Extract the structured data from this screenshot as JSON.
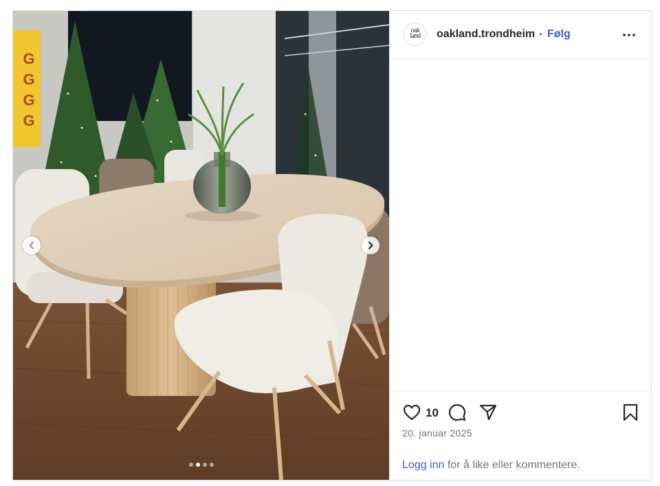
{
  "post": {
    "media": {
      "banner_letters": [
        "G",
        "G",
        "G",
        "G"
      ],
      "slide_index": 2,
      "slide_count": 4
    },
    "header": {
      "avatar_text_line1": "oak",
      "avatar_text_line2": "land",
      "username": "oakland.trondheim",
      "separator": "•",
      "follow_label": "Følg"
    },
    "actions": {
      "like_count": "10",
      "date": "20. januar 2025"
    },
    "login_prompt": {
      "link_text": "Logg inn",
      "rest_text": " for å like eller kommentere."
    }
  },
  "colors": {
    "link_blue": "#3d5bd4",
    "border": "#dbdbdb",
    "text": "#262626",
    "muted": "#737373"
  }
}
